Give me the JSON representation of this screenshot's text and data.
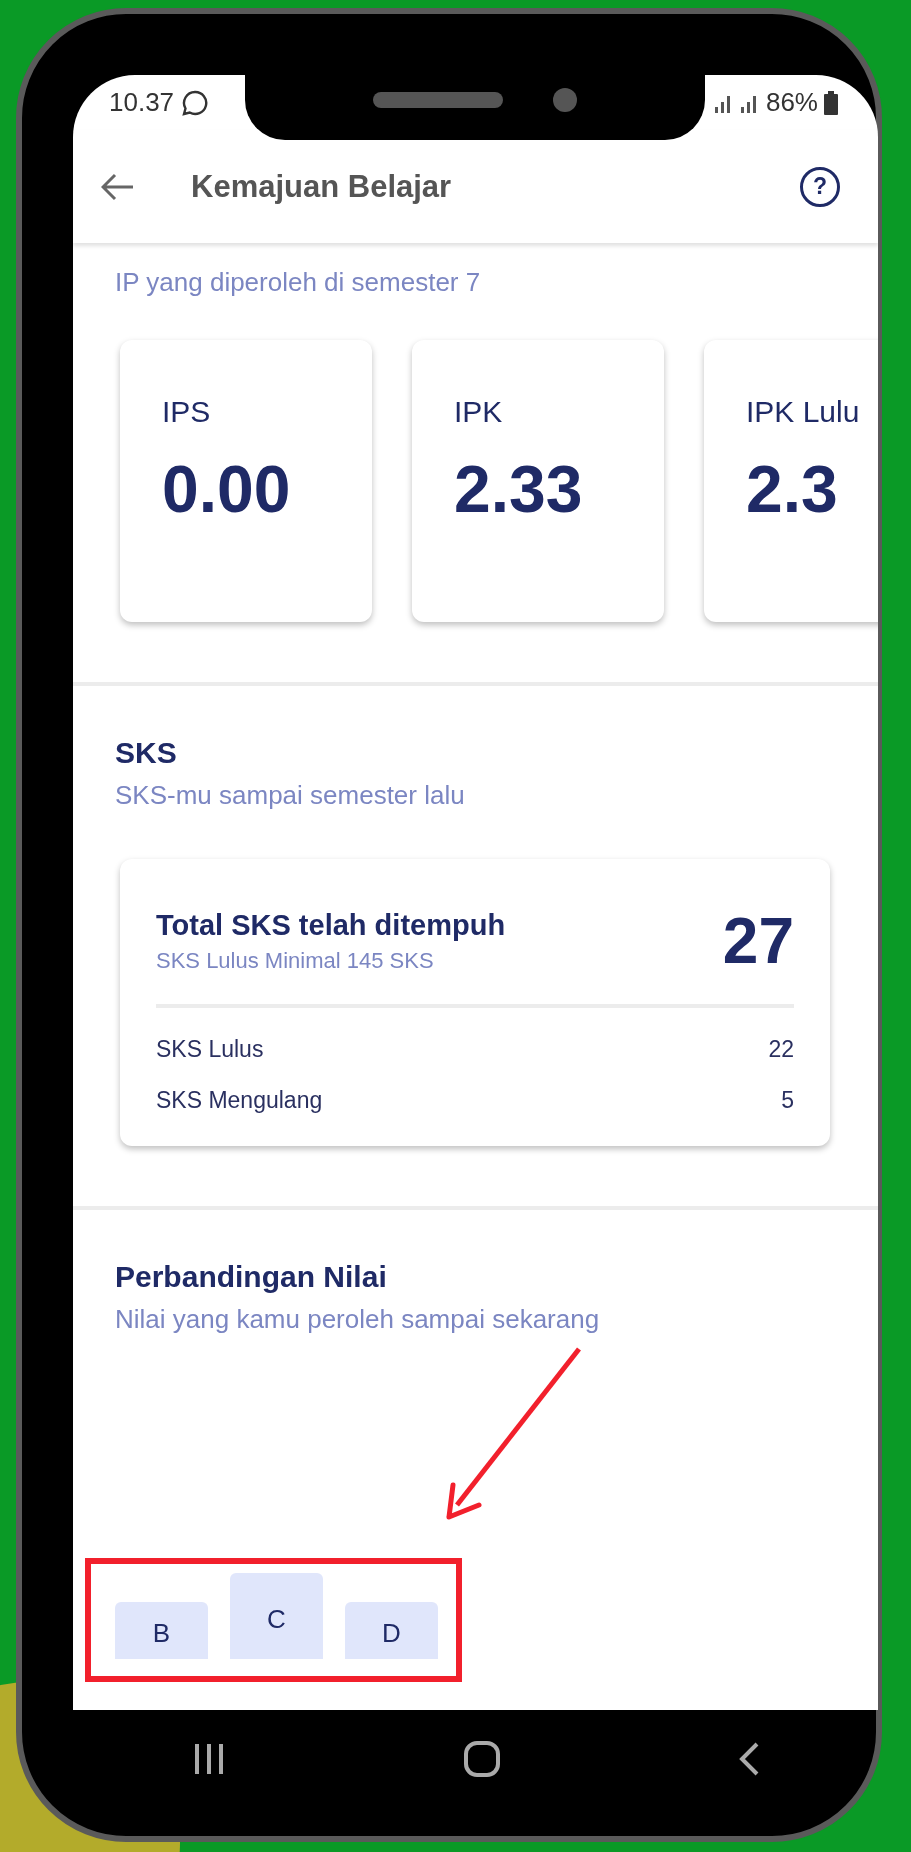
{
  "status_bar": {
    "time": "10.37",
    "battery": "86%"
  },
  "header": {
    "title": "Kemajuan Belajar",
    "help": "?"
  },
  "ip_section": {
    "subtitle": "IP yang diperoleh di semester 7",
    "cards": [
      {
        "label": "IPS",
        "value": "0.00"
      },
      {
        "label": "IPK",
        "value": "2.33"
      },
      {
        "label": "IPK Lulu",
        "value": "2.3"
      }
    ]
  },
  "sks_section": {
    "title": "SKS",
    "subtitle": "SKS-mu sampai semester lalu",
    "card": {
      "title": "Total SKS telah ditempuh",
      "subtitle": "SKS Lulus Minimal 145 SKS",
      "total": "27",
      "rows": [
        {
          "label": "SKS Lulus",
          "value": "22"
        },
        {
          "label": "SKS Mengulang",
          "value": "5"
        }
      ]
    }
  },
  "comparison_section": {
    "title": "Perbandingan Nilai",
    "subtitle": "Nilai yang kamu peroleh sampai sekarang",
    "grade_bars": [
      {
        "label": "B",
        "raised": false
      },
      {
        "label": "C",
        "raised": true
      },
      {
        "label": "D",
        "raised": false
      }
    ]
  }
}
